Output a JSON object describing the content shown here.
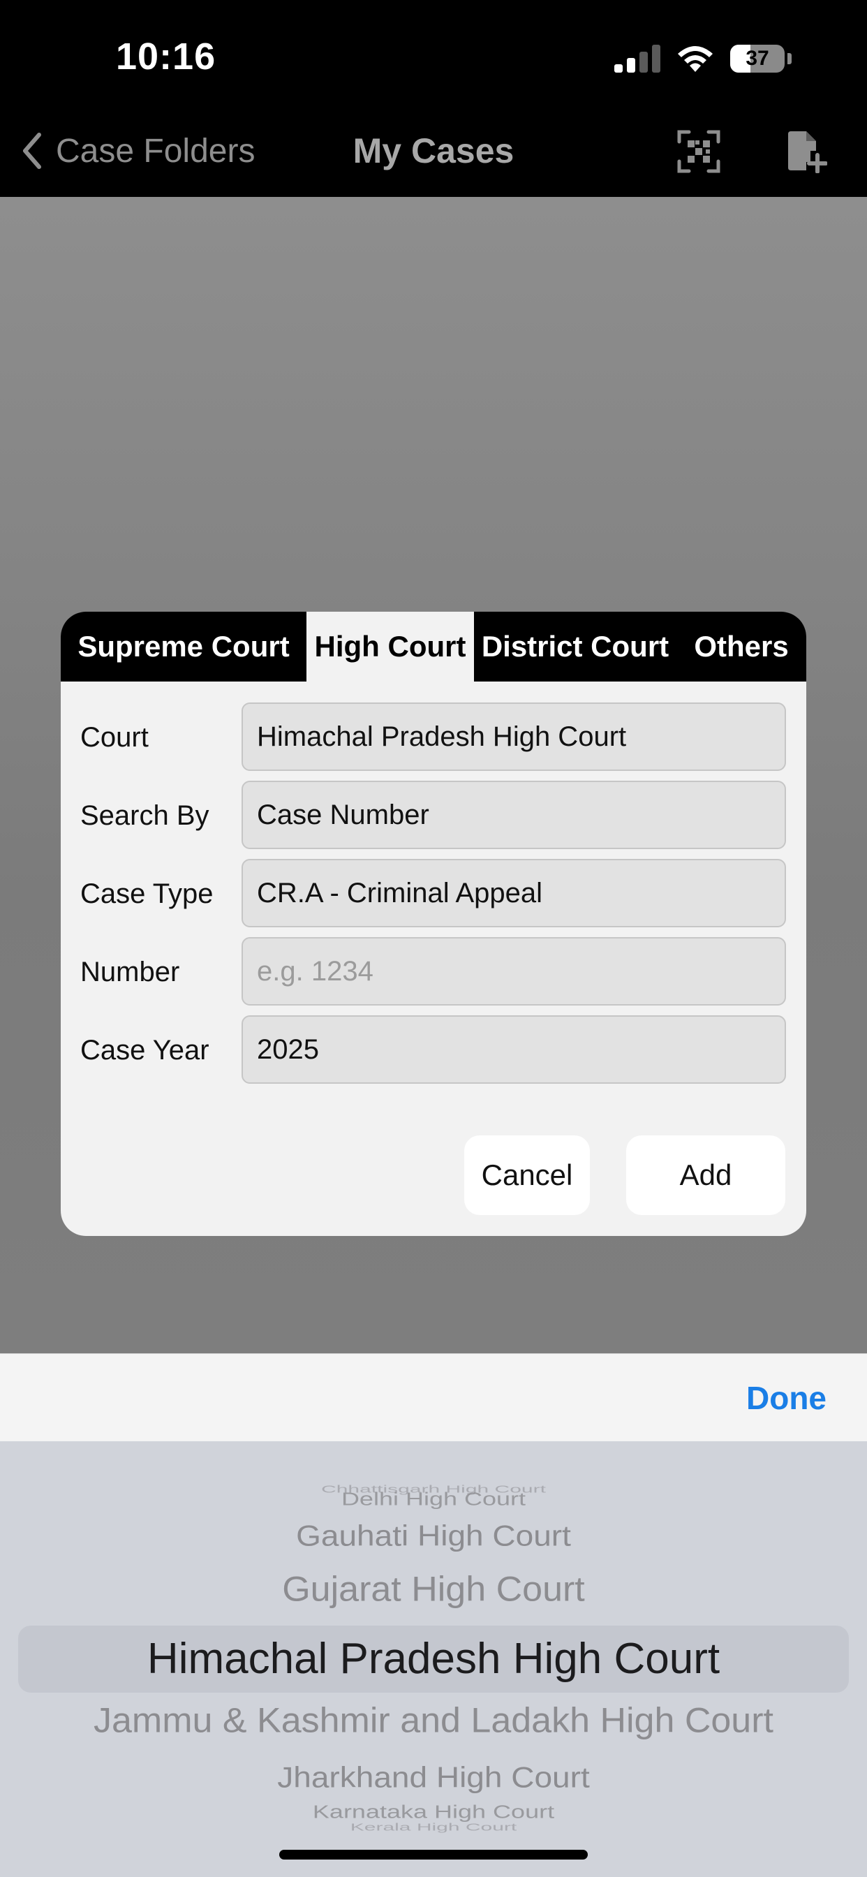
{
  "status_bar": {
    "time": "10:16",
    "battery_level": "37",
    "battery_fraction": 0.37
  },
  "nav": {
    "back_label": "Case Folders",
    "title": "My Cases"
  },
  "dialog": {
    "tabs": [
      "Supreme Court",
      "High Court",
      "District Court",
      "Others"
    ],
    "active_tab": "High Court",
    "fields": {
      "court": {
        "label": "Court",
        "value": "Himachal Pradesh High Court"
      },
      "search_by": {
        "label": "Search By",
        "value": "Case Number"
      },
      "case_type": {
        "label": "Case Type",
        "value": "CR.A - Criminal Appeal"
      },
      "number": {
        "label": "Number",
        "placeholder": "e.g. 1234"
      },
      "case_year": {
        "label": "Case Year",
        "value": "2025"
      }
    },
    "cancel_label": "Cancel",
    "add_label": "Add"
  },
  "picker": {
    "done_label": "Done",
    "items": [
      "Chhattisgarh High Court",
      "Delhi High Court",
      "Gauhati High Court",
      "Gujarat High Court",
      "Himachal Pradesh High Court",
      "Jammu & Kashmir and Ladakh High Court",
      "Jharkhand High Court",
      "Karnataka High Court",
      "Kerala High Court"
    ],
    "selected": "Himachal Pradesh High Court"
  },
  "colors": {
    "accent": "#1a7ee6",
    "dialog_bg": "#f2f2f2",
    "tab_bar": "#000000",
    "picker_bg": "#d0d3da"
  },
  "icons": [
    "chevron-left-icon",
    "qr-code-icon",
    "add-document-icon",
    "signal-icon",
    "wifi-icon",
    "battery-icon"
  ]
}
